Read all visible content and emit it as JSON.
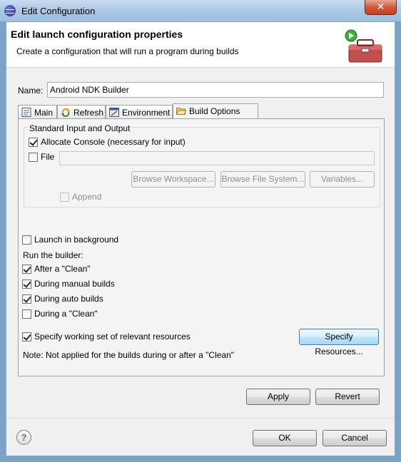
{
  "window": {
    "title": "Edit Configuration",
    "close_symbol": "✕"
  },
  "header": {
    "title": "Edit launch configuration properties",
    "description": "Create a configuration that will run a program during builds"
  },
  "name": {
    "label": "Name:",
    "value": "Android NDK Builder"
  },
  "tabs": [
    {
      "label": "Main",
      "icon": "document-icon"
    },
    {
      "label": "Refresh",
      "icon": "refresh-icon"
    },
    {
      "label": "Environment",
      "icon": "environment-icon"
    },
    {
      "label": "Build Options",
      "icon": "folder-open-icon",
      "active": true
    }
  ],
  "std_io": {
    "title": "Standard Input and Output",
    "allocate_console": {
      "label": "Allocate Console (necessary for input)",
      "checked": true
    },
    "file": {
      "label": "File",
      "checked": false,
      "value": ""
    },
    "browse_workspace": "Browse Workspace...",
    "browse_file_system": "Browse File System...",
    "variables": "Variables...",
    "append": {
      "label": "Append",
      "checked": false
    }
  },
  "launch_background": {
    "label": "Launch in background",
    "checked": false
  },
  "run_builder": {
    "label": "Run the builder:",
    "after_clean": {
      "label": "After a \"Clean\"",
      "checked": true
    },
    "during_manual": {
      "label": "During manual builds",
      "checked": true
    },
    "during_auto": {
      "label": "During auto builds",
      "checked": true
    },
    "during_clean": {
      "label": "During a \"Clean\"",
      "checked": false
    }
  },
  "working_set": {
    "label": "Specify working set of relevant resources",
    "checked": true
  },
  "specify_resources": "Specify Resources...",
  "note": "Note: Not applied for the builds during or after a \"Clean\"",
  "buttons": {
    "apply": "Apply",
    "revert": "Revert",
    "ok": "OK",
    "cancel": "Cancel",
    "help": "?"
  }
}
